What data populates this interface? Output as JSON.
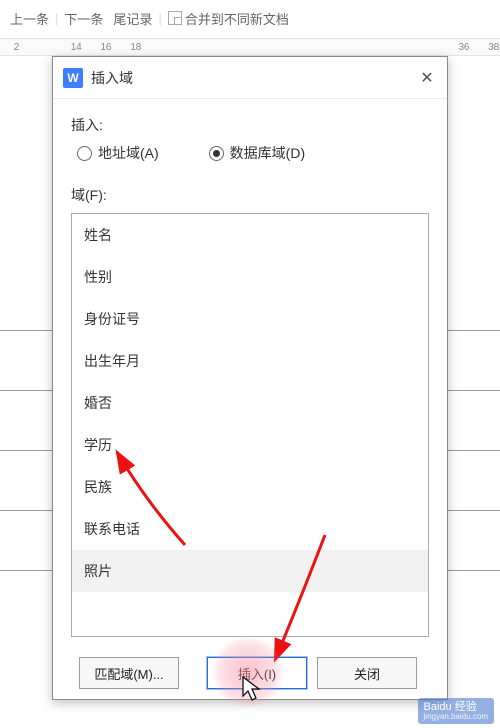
{
  "bg_toolbar": {
    "prev": "上一条",
    "next": "下一条",
    "tail": "尾记录",
    "merge": "合并到不同新文档"
  },
  "ruler_marks": [
    "2",
    "",
    "14",
    "16",
    "18",
    "",
    "",
    "",
    "",
    "",
    "",
    "",
    "",
    "",
    "",
    "36",
    "38"
  ],
  "dialog": {
    "app_icon_letter": "W",
    "title": "插入域",
    "insert_label": "插入:",
    "radio_address": "地址域(A)",
    "radio_database": "数据库域(D)",
    "field_label": "域(F):",
    "fields": [
      "姓名",
      "性别",
      "身份证号",
      "出生年月",
      "婚否",
      "学历",
      "民族",
      "联系电话",
      "照片"
    ],
    "selected_index": 8,
    "buttons": {
      "match": "匹配域(M)...",
      "insert": "插入(I)",
      "close": "关闭"
    }
  },
  "watermark": {
    "brand": "Baidu 经验",
    "sub": "jingyan.baidu.com"
  }
}
